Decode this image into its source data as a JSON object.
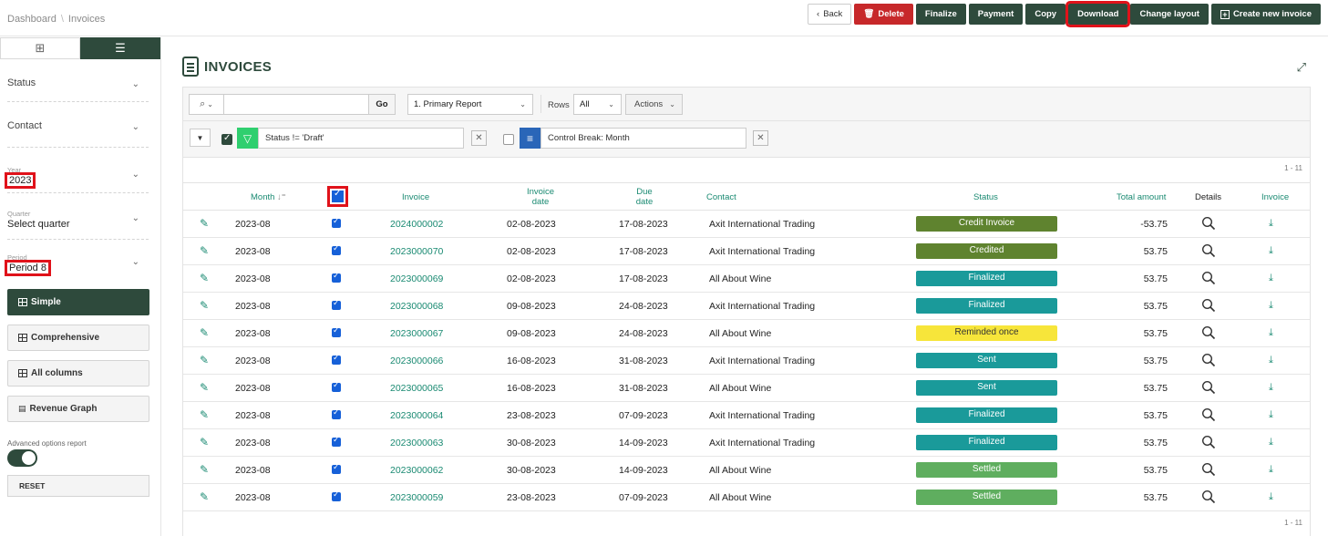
{
  "breadcrumb": [
    "Dashboard",
    "Invoices"
  ],
  "toolbar": {
    "back": "Back",
    "delete": "Delete",
    "finalize": "Finalize",
    "payment": "Payment",
    "copy": "Copy",
    "download": "Download",
    "change_layout": "Change layout",
    "create_new": "Create new invoice"
  },
  "sidebar": {
    "status_label": "Status",
    "contact_label": "Contact",
    "year_label": "Year",
    "year_value": "2023",
    "quarter_label": "Quarter",
    "quarter_value": "Select quarter",
    "period_label": "Period",
    "period_value": "Period 8",
    "layouts": [
      "Simple",
      "Comprehensive",
      "All columns",
      "Revenue Graph"
    ],
    "advanced_label": "Advanced options report",
    "reset": "RESET"
  },
  "page": {
    "title": "INVOICES"
  },
  "report": {
    "go": "Go",
    "report_select": "1. Primary Report",
    "rows_label": "Rows",
    "rows_value": "All",
    "actions": "Actions",
    "filter1": "Status != 'Draft'",
    "filter2": "Control Break: Month",
    "count": "1 - 11"
  },
  "columns": {
    "month": "Month",
    "invoice": "Invoice",
    "invoice_date_1": "Invoice",
    "invoice_date_2": "date",
    "due_date_1": "Due",
    "due_date_2": "date",
    "contact": "Contact",
    "status": "Status",
    "total": "Total amount",
    "details": "Details",
    "invoice_dl": "Invoice"
  },
  "status_colors": {
    "Credit Invoice": "#5f832f",
    "Credited": "#5f832f",
    "Finalized": "#1a9a9a",
    "Reminded once": "#f7e53a",
    "Sent": "#1a9a9a",
    "Settled": "#5fae5f"
  },
  "rows": [
    {
      "month": "2023-08",
      "invoice": "2024000002",
      "invoice_date": "02-08-2023",
      "due_date": "17-08-2023",
      "contact": "Axit International Trading",
      "status": "Credit Invoice",
      "total": "-53.75"
    },
    {
      "month": "2023-08",
      "invoice": "2023000070",
      "invoice_date": "02-08-2023",
      "due_date": "17-08-2023",
      "contact": "Axit International Trading",
      "status": "Credited",
      "total": "53.75"
    },
    {
      "month": "2023-08",
      "invoice": "2023000069",
      "invoice_date": "02-08-2023",
      "due_date": "17-08-2023",
      "contact": "All About Wine",
      "status": "Finalized",
      "total": "53.75"
    },
    {
      "month": "2023-08",
      "invoice": "2023000068",
      "invoice_date": "09-08-2023",
      "due_date": "24-08-2023",
      "contact": "Axit International Trading",
      "status": "Finalized",
      "total": "53.75"
    },
    {
      "month": "2023-08",
      "invoice": "2023000067",
      "invoice_date": "09-08-2023",
      "due_date": "24-08-2023",
      "contact": "All About Wine",
      "status": "Reminded once",
      "total": "53.75"
    },
    {
      "month": "2023-08",
      "invoice": "2023000066",
      "invoice_date": "16-08-2023",
      "due_date": "31-08-2023",
      "contact": "Axit International Trading",
      "status": "Sent",
      "total": "53.75"
    },
    {
      "month": "2023-08",
      "invoice": "2023000065",
      "invoice_date": "16-08-2023",
      "due_date": "31-08-2023",
      "contact": "All About Wine",
      "status": "Sent",
      "total": "53.75"
    },
    {
      "month": "2023-08",
      "invoice": "2023000064",
      "invoice_date": "23-08-2023",
      "due_date": "07-09-2023",
      "contact": "Axit International Trading",
      "status": "Finalized",
      "total": "53.75"
    },
    {
      "month": "2023-08",
      "invoice": "2023000063",
      "invoice_date": "30-08-2023",
      "due_date": "14-09-2023",
      "contact": "Axit International Trading",
      "status": "Finalized",
      "total": "53.75"
    },
    {
      "month": "2023-08",
      "invoice": "2023000062",
      "invoice_date": "30-08-2023",
      "due_date": "14-09-2023",
      "contact": "All About Wine",
      "status": "Settled",
      "total": "53.75"
    },
    {
      "month": "2023-08",
      "invoice": "2023000059",
      "invoice_date": "23-08-2023",
      "due_date": "07-09-2023",
      "contact": "All About Wine",
      "status": "Settled",
      "total": "53.75"
    }
  ]
}
